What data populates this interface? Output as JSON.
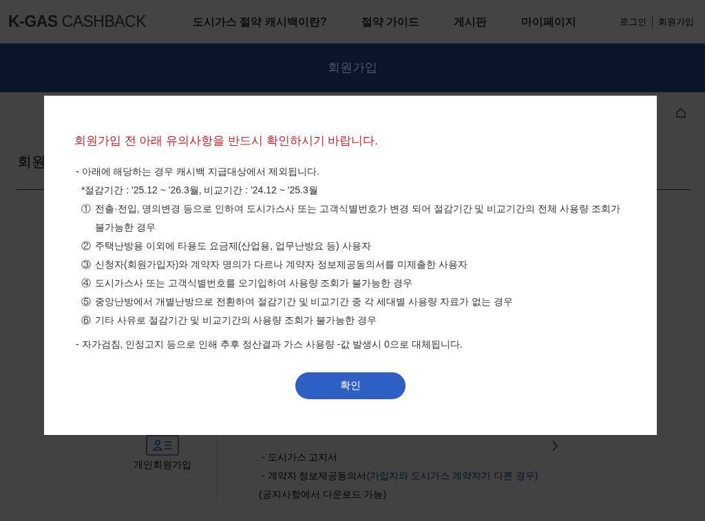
{
  "header": {
    "logo": "**K-GAS** CASHBACK",
    "nav": [
      "도시가스 절약 캐시백이란?",
      "절약 가이드",
      "게시판",
      "마이페이지"
    ],
    "user_links": [
      "로그인",
      "회원가입"
    ]
  },
  "banner": {
    "title": "회원가입"
  },
  "section": {
    "title": "회원"
  },
  "signup_option": {
    "label": "개인회원가입",
    "documents": [
      {
        "text": "- 도시가스 고지서"
      },
      {
        "text": "- 계약자 정보제공동의서",
        "note": "(가입자와 도시가스 계약자가 다른 경우)"
      },
      {
        "text": "(공지사항에서 다운로드 가능)"
      }
    ]
  },
  "modal": {
    "title": "회원가입 전 아래 유의사항을 반드시 확인하시기 바랍니다.",
    "intro": "- 아래에 해당하는 경우 캐시백 지급대상에서 제외됩니다.",
    "period_note": "*절감기간 : '25.12 ~ '26.3월, 비교기간 : '24.12 ~ '25.3월",
    "items": [
      {
        "number": "①",
        "text": "전출·전입, 명의변경 등으로 인하여 도시가스사 또는 고객식별번호가 변경 되어 절감기간 및 비교기간의 전체 사용량 조회가 불가능한 경우"
      },
      {
        "number": "②",
        "text": "주택난방용 이외에 타용도 요금제(산업용, 업무난방요 등) 사용자"
      },
      {
        "number": "③",
        "text": "신청자(회원가입자)와 계약자 명의가 다르나 계약자 정보제공동의서를 미제출한 사용자"
      },
      {
        "number": "④",
        "text": "도시가스사 또는 고객식별번호를 오기입하여 사용량 조회가 불가능한 경우"
      },
      {
        "number": "⑤",
        "text": "중앙난방에서 개별난방으로 전환하여 절감기간 및 비교기간 중 각 세대별 사용량 자료가 없는 경우"
      },
      {
        "number": "⑥",
        "text": "기타 사유로 절감기간 및 비교기간의 사용량 조회가 불가능한 경우"
      }
    ],
    "footnote": "- 자가검침, 인정고지 등으로 인해 추후 정산결과 가스 사용량 -값 발생시 0으로 대체됩니다.",
    "confirm_button": "확인"
  }
}
